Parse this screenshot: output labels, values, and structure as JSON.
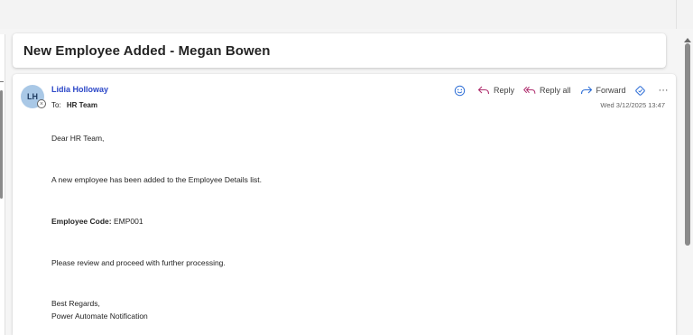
{
  "email": {
    "subject": "New Employee Added - Megan Bowen",
    "sender": {
      "name": "Lidia Holloway",
      "initials": "LH"
    },
    "to_label": "To:",
    "to_value": "HR Team",
    "timestamp": "Wed 3/12/2025 13:47",
    "actions": {
      "reply": "Reply",
      "reply_all": "Reply all",
      "forward": "Forward"
    },
    "body": {
      "greeting": "Dear HR Team,",
      "line1": "A new employee has been added to the Employee Details list.",
      "code_label": "Employee Code:",
      "code_value": "EMP001",
      "line3": "Please review and proceed with further processing.",
      "sign_off": "Best Regards,",
      "signature": "Power Automate Notification"
    }
  },
  "icons": {
    "emoji": "smiley-icon",
    "reply": "reply-arrow-icon",
    "reply_all": "reply-all-arrow-icon",
    "forward": "forward-arrow-icon",
    "teams": "share-to-teams-icon",
    "more": "more-options-icon",
    "presence": "presence-offline-icon"
  },
  "colors": {
    "accent": "#2b47c8",
    "reply_icon": "#b0306f",
    "forward_icon": "#2f6fd6",
    "avatar_bg": "#a9c8e6"
  }
}
